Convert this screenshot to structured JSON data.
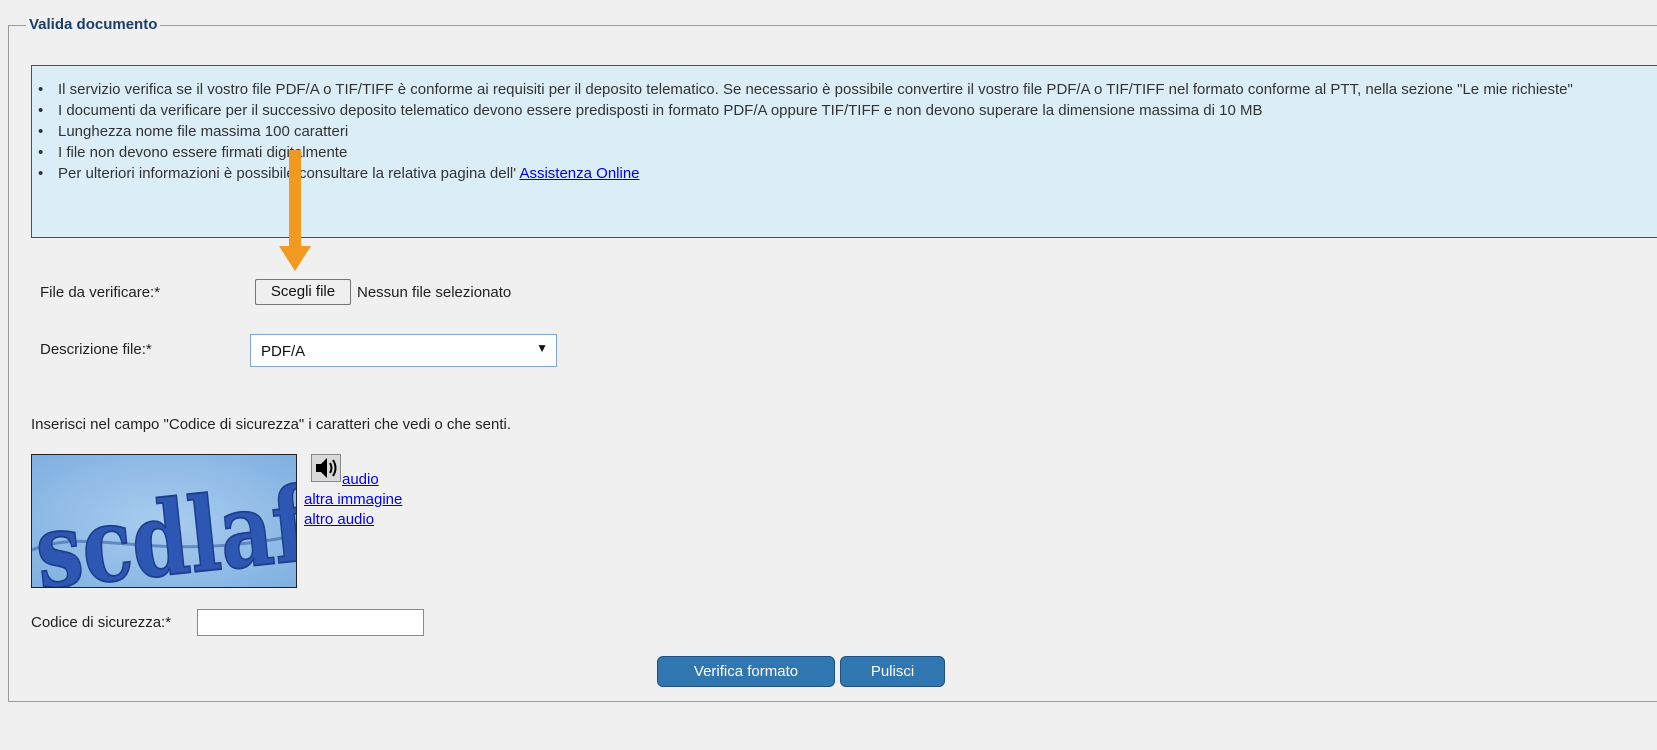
{
  "form": {
    "legend": "Valida documento",
    "info": [
      {
        "text": "Il servizio verifica se il vostro file PDF/A o TIF/TIFF è conforme ai requisiti per il deposito telematico. Se necessario è possibile convertire il vostro file PDF/A o TIF/TIFF nel formato conforme al PTT, nella sezione \"Le mie richieste\""
      },
      {
        "text": "I documenti da verificare per il successivo deposito telematico devono essere predisposti in formato PDF/A oppure TIF/TIFF e non devono superare la dimensione massima di 10 MB"
      },
      {
        "text": "Lunghezza nome file massima 100 caratteri"
      },
      {
        "text": "I file non devono essere firmati digitalmente"
      },
      {
        "text": "Per ulteriori informazioni è possibile consultare la relativa pagina dell'",
        "link": "Assistenza Online"
      }
    ],
    "file_label": "File da verificare:*",
    "file_button": "Scegli file",
    "file_status": "Nessun file selezionato",
    "description_label": "Descrizione file:*",
    "description_value": "PDF/A",
    "captcha_instruction": "Inserisci nel campo \"Codice di sicurezza\" i caratteri che vedi o che senti.",
    "captcha_text": "scdlaftt",
    "audio_link": "audio",
    "other_image_link": "altra immagine",
    "other_audio_link": "altro audio",
    "security_code_label": "Codice di sicurezza:*",
    "security_code_value": "",
    "verify_button": "Verifica formato",
    "clear_button": "Pulisci"
  },
  "icons": {
    "speaker": "speaker-icon",
    "arrow": "arrow-down-icon",
    "dropdown": "chevron-down-icon"
  },
  "colors": {
    "info_background": "#dbeef7",
    "info_border": "#2c5780",
    "legend": "#1b3e6b",
    "button": "#3077b2",
    "arrow": "#f29a1f",
    "link": "#0000ee"
  }
}
